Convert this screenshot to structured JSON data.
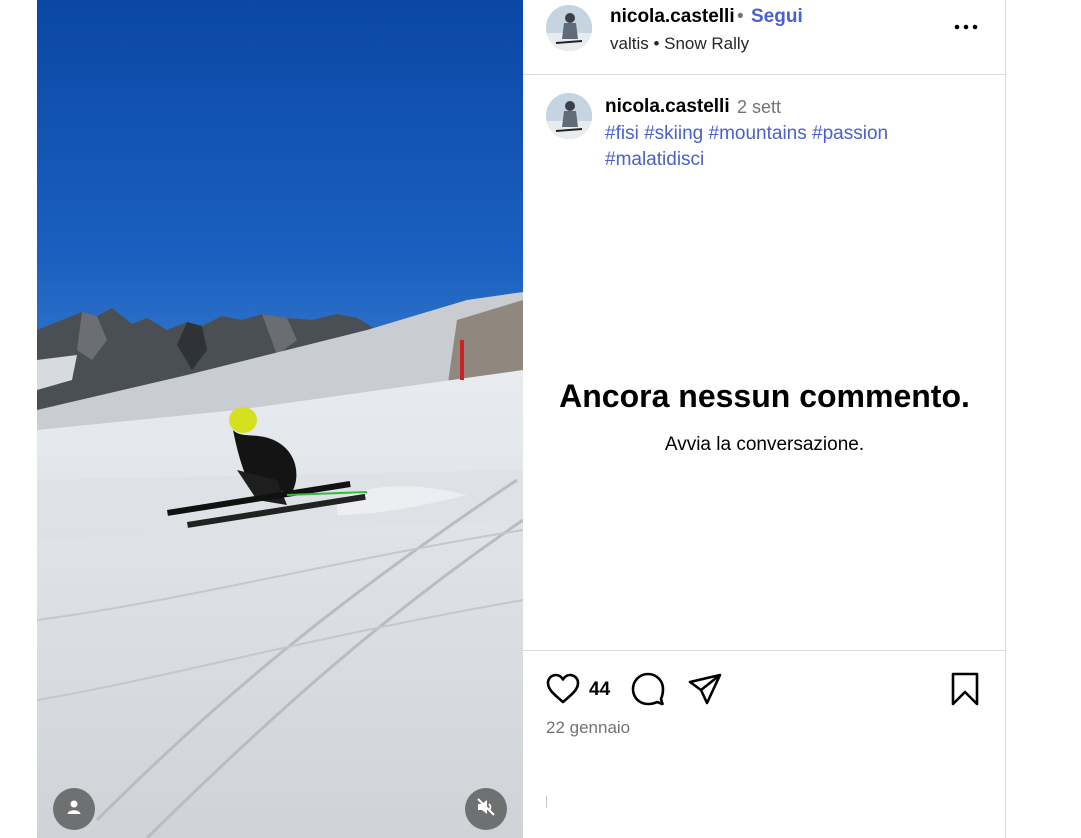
{
  "post": {
    "username": "nicola.castelli",
    "separator": "•",
    "follow_label": "Segui",
    "subtitle": "valtis • Snow Rally",
    "more_icon": "more-horizontal-icon"
  },
  "caption": {
    "username": "nicola.castelli",
    "time": "2 sett",
    "hashtags": [
      "#fisi",
      "#skiing",
      "#mountains",
      "#passion",
      "#malatidisci"
    ]
  },
  "comments": {
    "empty_title": "Ancora nessun commento.",
    "empty_subtitle": "Avvia la conversazione."
  },
  "actions": {
    "like_count": "44",
    "date": "22 gennaio",
    "icons": [
      "heart-icon",
      "comment-icon",
      "share-icon",
      "bookmark-icon"
    ]
  },
  "media": {
    "icons": [
      "user-tag-icon",
      "mute-icon"
    ]
  },
  "colors": {
    "link": "#4a5fd1",
    "secondary_text": "#737373",
    "border": "#dbdbdb"
  }
}
